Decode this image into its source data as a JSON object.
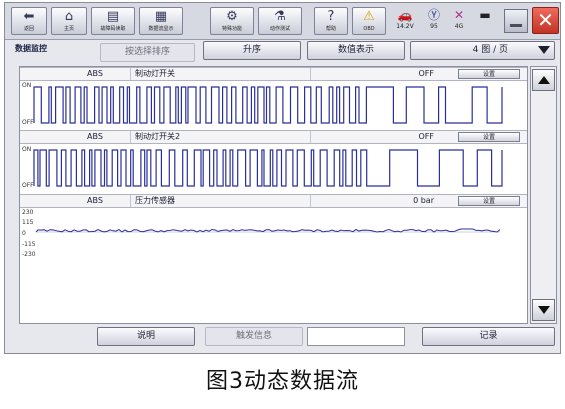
{
  "toolbar": {
    "buttons": [
      {
        "icon": "back-icon",
        "glyph": "⬅",
        "label": "返回"
      },
      {
        "icon": "home-icon",
        "glyph": "⌂",
        "label": "主页"
      },
      {
        "icon": "fault-code-icon",
        "glyph": "▤",
        "label": "故障码读取"
      },
      {
        "icon": "data-stream-icon",
        "glyph": "▦",
        "label": "数据流显示"
      },
      {
        "icon": "special-function-icon",
        "glyph": "⚙",
        "label": "特殊功能"
      },
      {
        "icon": "actuator-test-icon",
        "glyph": "⚗",
        "label": "动作测试"
      },
      {
        "icon": "help-icon",
        "glyph": "?",
        "label": "帮助"
      },
      {
        "icon": "warning-icon",
        "glyph": "⚠",
        "label": "OBD"
      }
    ],
    "status": [
      {
        "icon": "car-battery-icon",
        "glyph": "🚗",
        "label": "14.2V"
      },
      {
        "icon": "signal-icon",
        "glyph": "Ⓨ",
        "label": "95"
      },
      {
        "icon": "no-connection-icon",
        "glyph": "✕",
        "label": "4G"
      },
      {
        "icon": "battery-icon",
        "glyph": "▬",
        "label": ""
      }
    ]
  },
  "controls": {
    "title": "数据监控",
    "sort_by_selection": "按选择排序",
    "ascending": "升序",
    "numeric_display": "数值表示",
    "page_select": "4 图 / 页"
  },
  "signals": [
    {
      "system": "ABS",
      "name": "制动灯开关",
      "value": "OFF",
      "setting": "设置",
      "y_top": "ON",
      "y_bottom": "OFF"
    },
    {
      "system": "ABS",
      "name": "制动灯开关2",
      "value": "OFF",
      "setting": "设置",
      "y_top": "ON",
      "y_bottom": "OFF"
    },
    {
      "system": "ABS",
      "name": "压力传感器",
      "value": "0 bar",
      "setting": "设置",
      "y_ticks": [
        "230",
        "115",
        "0",
        "-115",
        "-230"
      ]
    }
  ],
  "bottom": {
    "description": "说明",
    "trigger_info": "触发信息",
    "trigger_value": "",
    "record": "记录"
  },
  "caption": "图3动态数据流"
}
